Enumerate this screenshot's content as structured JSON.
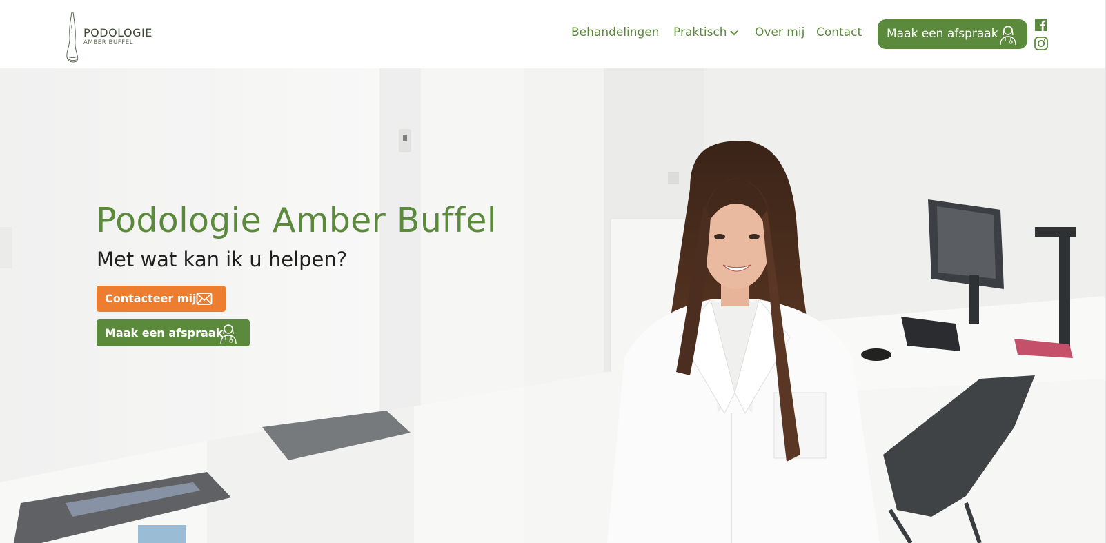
{
  "logo": {
    "title": "PODOLOGIE",
    "subtitle": "AMBER BUFFEL"
  },
  "nav": {
    "items": [
      {
        "label": "Behandelingen"
      },
      {
        "label": "Praktisch",
        "has_dropdown": true
      },
      {
        "label": "Over mij"
      },
      {
        "label": "Contact"
      }
    ],
    "cta_label": "Maak een afspraak"
  },
  "social": {
    "icons": [
      "facebook-icon",
      "instagram-icon"
    ]
  },
  "hero": {
    "title": "Podologie Amber Buffel",
    "subtitle": "Met wat kan ik u helpen?",
    "contact_button": "Contacteer mij",
    "appointment_button": "Maak een afspraak"
  },
  "colors": {
    "brand_green": "#5b8a3c",
    "accent_orange": "#ed7d2f",
    "text_dark": "#1f1f1f"
  }
}
